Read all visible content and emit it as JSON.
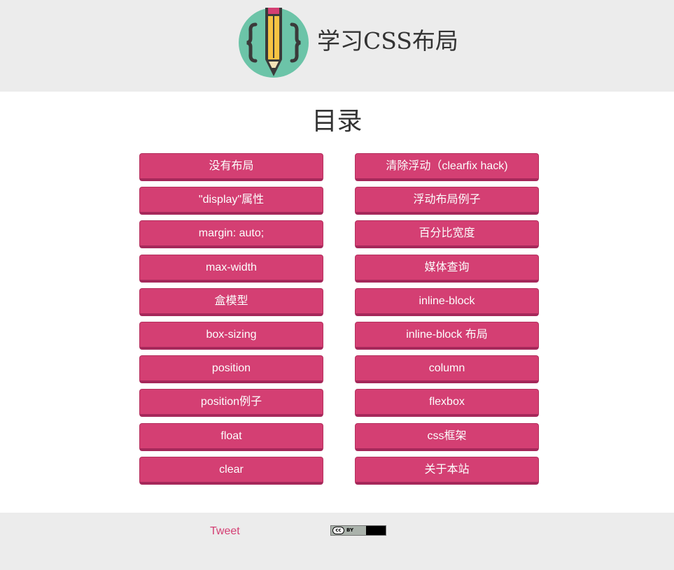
{
  "header": {
    "title": "学习CSS布局"
  },
  "main": {
    "heading": "目录",
    "left_items": [
      {
        "label": "没有布局"
      },
      {
        "label": "\"display\"属性"
      },
      {
        "label": "margin: auto;"
      },
      {
        "label": "max-width"
      },
      {
        "label": "盒模型"
      },
      {
        "label": "box-sizing"
      },
      {
        "label": "position"
      },
      {
        "label": "position例子"
      },
      {
        "label": "float"
      },
      {
        "label": "clear"
      }
    ],
    "right_items": [
      {
        "label": "清除浮动（clearfix hack)"
      },
      {
        "label": "浮动布局例子"
      },
      {
        "label": "百分比宽度"
      },
      {
        "label": "媒体查询"
      },
      {
        "label": "inline-block"
      },
      {
        "label": "inline-block 布局"
      },
      {
        "label": "column"
      },
      {
        "label": "flexbox"
      },
      {
        "label": "css框架"
      },
      {
        "label": "关于本站"
      }
    ]
  },
  "footer": {
    "tweet_label": "Tweet",
    "license_badge_text": "cc BY"
  },
  "colors": {
    "accent": "#d43f73",
    "header_bg": "#ececec",
    "logo_circle": "#6cc4a8",
    "pencil_yellow": "#f6c343"
  },
  "icons": {
    "logo": "pencil-braces-icon",
    "license": "cc-by-icon"
  }
}
